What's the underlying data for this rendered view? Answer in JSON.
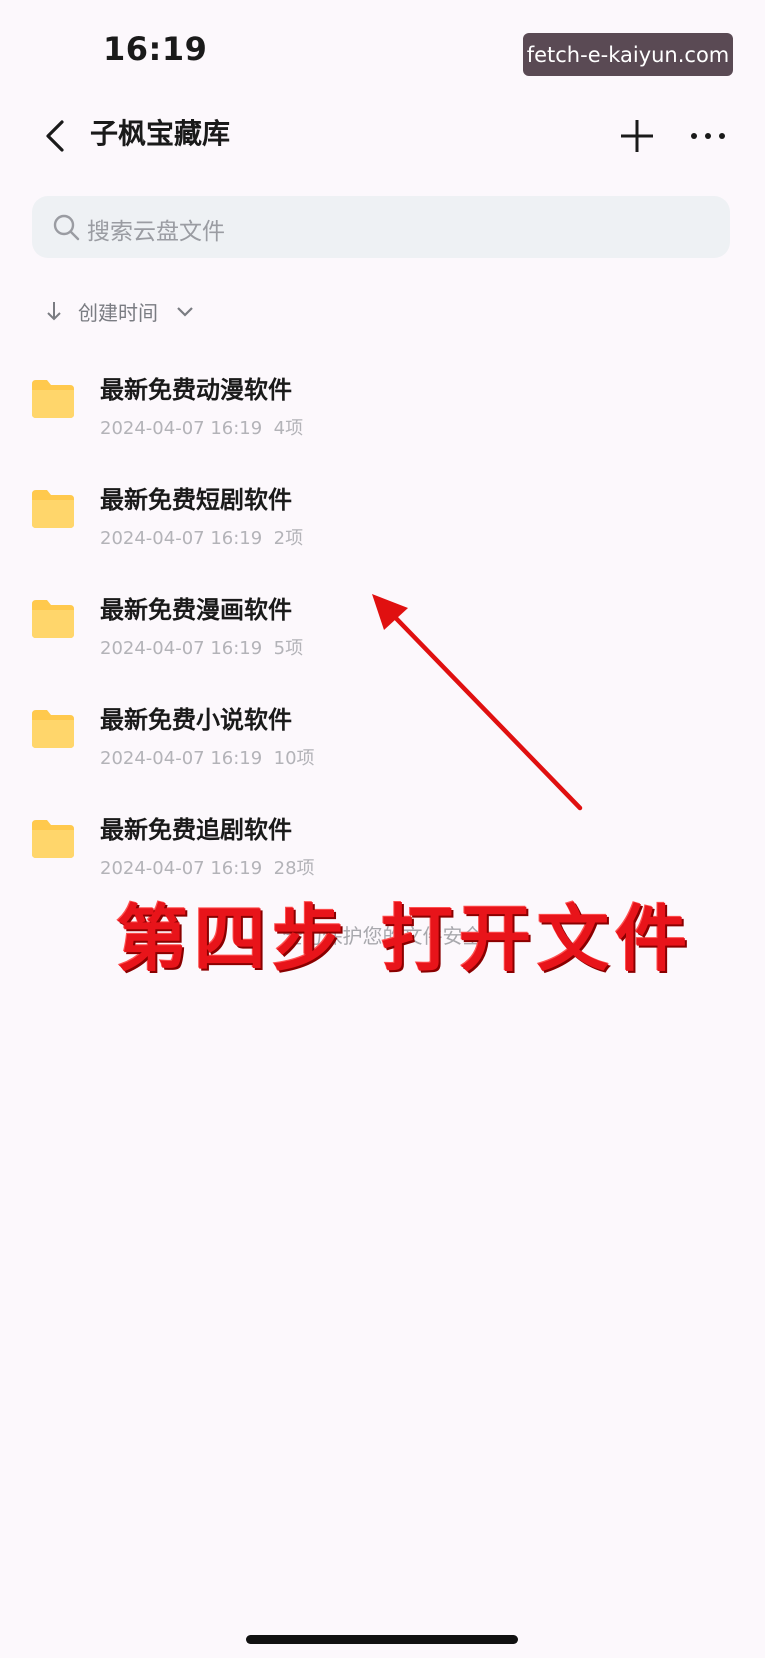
{
  "status_bar": {
    "time": "16:19",
    "watermark": "fetch-e-kaiyun.com"
  },
  "header": {
    "title": "子枫宝藏库",
    "back_icon": "chevron-left-icon",
    "add_icon": "plus-icon",
    "more_icon": "more-horizontal-icon"
  },
  "search": {
    "placeholder": "搜索云盘文件",
    "icon": "search-icon"
  },
  "sort": {
    "label": "创建时间",
    "direction_icon": "arrow-down-icon",
    "dropdown_icon": "chevron-down-icon"
  },
  "files": [
    {
      "name": "最新免费动漫软件",
      "date": "2024-04-07 16:19",
      "count": "4项"
    },
    {
      "name": "最新免费短剧软件",
      "date": "2024-04-07 16:19",
      "count": "2项"
    },
    {
      "name": "最新免费漫画软件",
      "date": "2024-04-07 16:19",
      "count": "5项"
    },
    {
      "name": "最新免费小说软件",
      "date": "2024-04-07 16:19",
      "count": "10项"
    },
    {
      "name": "最新免费追剧软件",
      "date": "2024-04-07 16:19",
      "count": "28项"
    }
  ],
  "footer_text": "全力保护您的文件安全",
  "annotation": {
    "text": "第四步 打开文件"
  },
  "colors": {
    "background": "#fcf8fc",
    "folder": "#ffc94d",
    "annotation": "#e8141a",
    "arrow": "#e01010"
  }
}
